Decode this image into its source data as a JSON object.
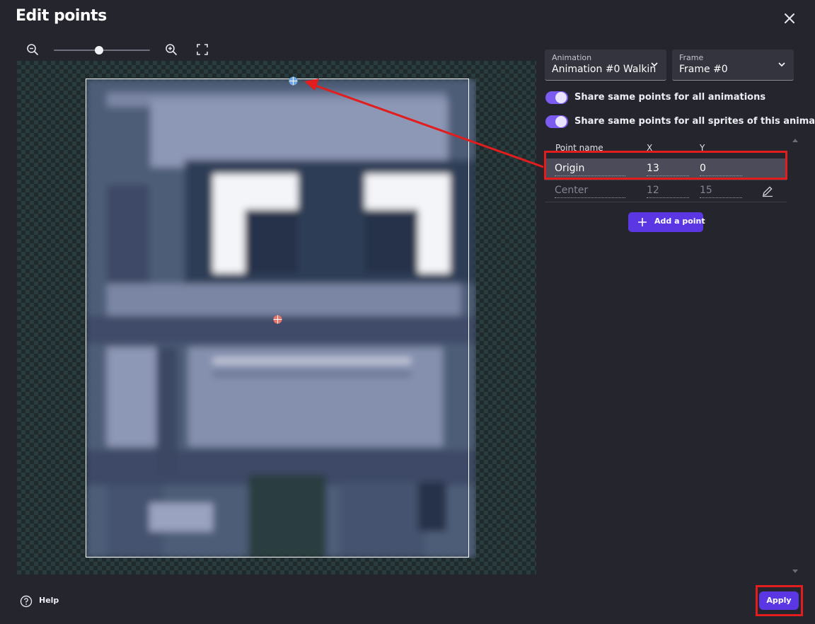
{
  "dialog": {
    "title": "Edit points"
  },
  "toolbar": {
    "zoom_out_icon": "zoom-out-icon",
    "zoom_in_icon": "zoom-in-icon",
    "fit_icon": "fullscreen-icon",
    "zoom_level": 0.47
  },
  "selectors": {
    "animation": {
      "label": "Animation",
      "value": "Animation #0 Walkin"
    },
    "frame": {
      "label": "Frame",
      "value": "Frame #0"
    }
  },
  "toggles": [
    {
      "label": "Share same points for all animations",
      "on": true
    },
    {
      "label": "Share same points for all sprites of this animation",
      "on": true
    }
  ],
  "table": {
    "headers": {
      "name": "Point name",
      "x": "X",
      "y": "Y"
    },
    "rows": [
      {
        "name": "Origin",
        "x": "13",
        "y": "0",
        "selected": true
      },
      {
        "name": "Center",
        "x": "12",
        "y": "15",
        "selected": false
      }
    ]
  },
  "add_button": {
    "label": "Add a point"
  },
  "footer": {
    "help_label": "Help",
    "apply_label": "Apply"
  },
  "colors": {
    "accent": "#5b37e3",
    "toggle": "#7b5bf0",
    "annotation": "#e11d1d",
    "origin_marker": "#6fa8e8",
    "center_marker": "#e8746a"
  }
}
